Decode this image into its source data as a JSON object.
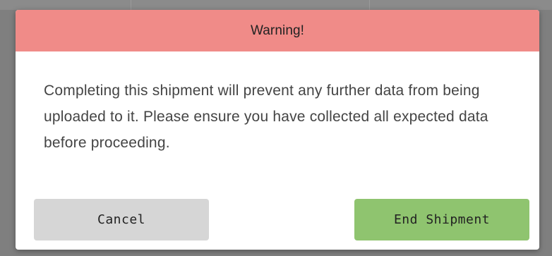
{
  "dialog": {
    "title": "Warning!",
    "message": "Completing this shipment will prevent any further data from being uploaded to it. Please ensure you have collected all expected data before proceeding.",
    "cancel_label": "Cancel",
    "confirm_label": "End Shipment"
  },
  "colors": {
    "header_background": "#f08b88",
    "cancel_button": "#d6d6d6",
    "confirm_button": "#8fc46f",
    "overlay": "#7f7f7f"
  }
}
